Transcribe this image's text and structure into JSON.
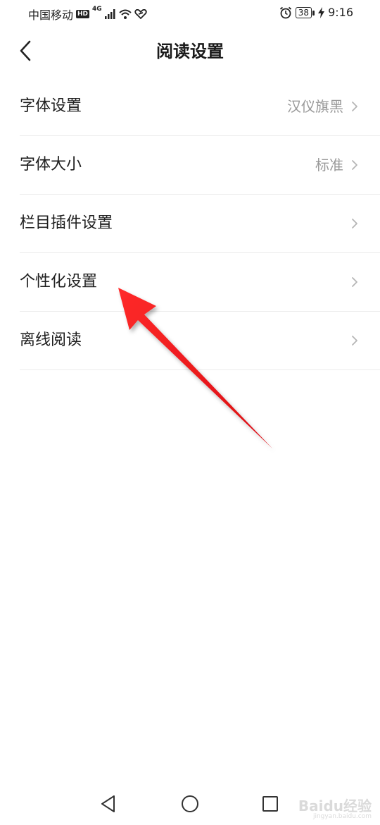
{
  "status_bar": {
    "carrier": "中国移动",
    "hd": "HD",
    "network": "4G",
    "battery": "38",
    "time": "9:16"
  },
  "header": {
    "title": "阅读设置",
    "back_icon": "chevron-left-icon"
  },
  "settings": [
    {
      "label": "字体设置",
      "value": "汉仪旗黑"
    },
    {
      "label": "字体大小",
      "value": "标准"
    },
    {
      "label": "栏目插件设置",
      "value": ""
    },
    {
      "label": "个性化设置",
      "value": ""
    },
    {
      "label": "离线阅读",
      "value": ""
    }
  ],
  "annotation": {
    "color": "#e8151b",
    "points_to": "个性化设置"
  },
  "nav_bar": {
    "icons": [
      "triangle-back-icon",
      "circle-home-icon",
      "square-recent-icon"
    ]
  },
  "watermark": {
    "text": "Baidu经验",
    "sub": "jingyan.baidu.com"
  },
  "colors": {
    "background": "#ffffff",
    "divider": "#ebebeb",
    "value_text": "#999999"
  }
}
